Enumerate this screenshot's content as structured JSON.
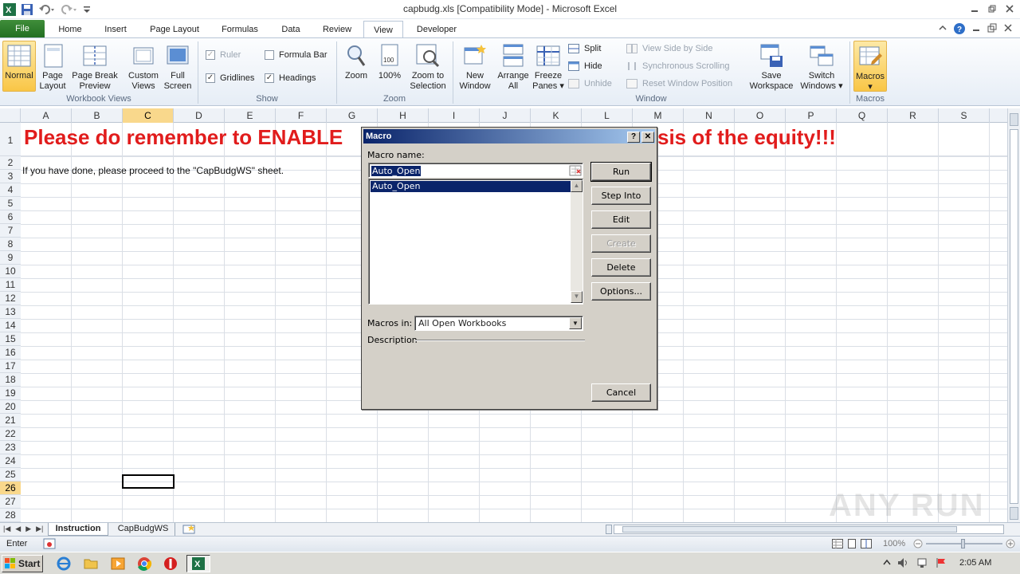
{
  "window": {
    "title": "capbudg.xls  [Compatibility Mode]  -  Microsoft Excel"
  },
  "ribbon_tabs": [
    "File",
    "Home",
    "Insert",
    "Page Layout",
    "Formulas",
    "Data",
    "Review",
    "View",
    "Developer"
  ],
  "active_tab": "View",
  "ribbon": {
    "workbook_views": {
      "label": "Workbook Views",
      "normal": "Normal",
      "page_layout_1": "Page",
      "page_layout_2": "Layout",
      "page_break_1": "Page Break",
      "page_break_2": "Preview",
      "custom_1": "Custom",
      "custom_2": "Views",
      "full_1": "Full",
      "full_2": "Screen"
    },
    "show": {
      "label": "Show",
      "ruler": "Ruler",
      "formula_bar": "Formula Bar",
      "gridlines": "Gridlines",
      "headings": "Headings",
      "check_mark": "✓"
    },
    "zoom": {
      "label": "Zoom",
      "zoom": "Zoom",
      "hundred": "100%",
      "zoom_sel_1": "Zoom to",
      "zoom_sel_2": "Selection"
    },
    "window": {
      "label": "Window",
      "new_1": "New",
      "new_2": "Window",
      "arrange_1": "Arrange",
      "arrange_2": "All",
      "freeze_1": "Freeze",
      "freeze_2": "Panes",
      "split": "Split",
      "hide": "Hide",
      "unhide": "Unhide",
      "side_by_side": "View Side by Side",
      "sync_scroll": "Synchronous Scrolling",
      "reset_pos": "Reset Window Position",
      "save_ws_1": "Save",
      "save_ws_2": "Workspace",
      "switch_1": "Switch",
      "switch_2": "Windows"
    },
    "macros": {
      "label": "Macros",
      "macros": "Macros"
    }
  },
  "columns": [
    "A",
    "B",
    "C",
    "D",
    "E",
    "F",
    "G",
    "H",
    "I",
    "J",
    "K",
    "L",
    "M",
    "N",
    "O",
    "P",
    "Q",
    "R",
    "S"
  ],
  "rows": [
    "1",
    "2",
    "3",
    "4",
    "5",
    "6",
    "7",
    "8",
    "9",
    "10",
    "11",
    "12",
    "13",
    "14",
    "15",
    "16",
    "17",
    "18",
    "19",
    "20",
    "21",
    "22",
    "23",
    "24",
    "25",
    "26",
    "27",
    "28"
  ],
  "cells": {
    "a1_left": "Please do remember to ENABLE",
    "a1_right": "sis of the equity!!!",
    "a3": "If you have done, please proceed to the \"CapBudgWS\" sheet."
  },
  "sheets": [
    "Instruction",
    "CapBudgWS"
  ],
  "active_sheet": "Instruction",
  "status": {
    "mode": "Enter",
    "zoom": "100%"
  },
  "dialog": {
    "title": "Macro",
    "help": "?",
    "close": "✕",
    "macro_name_label": "Macro name:",
    "macro_name_value": "Auto_Open",
    "macro_list": [
      "Auto_Open"
    ],
    "buttons": {
      "run": "Run",
      "step_into": "Step Into",
      "edit": "Edit",
      "create": "Create",
      "delete": "Delete",
      "options": "Options...",
      "cancel": "Cancel"
    },
    "macros_in_label": "Macros in:",
    "macros_in_value": "All Open Workbooks",
    "description_label": "Description"
  },
  "taskbar": {
    "start": "Start",
    "clock": "2:05 AM"
  },
  "watermark": "ANY RUN"
}
